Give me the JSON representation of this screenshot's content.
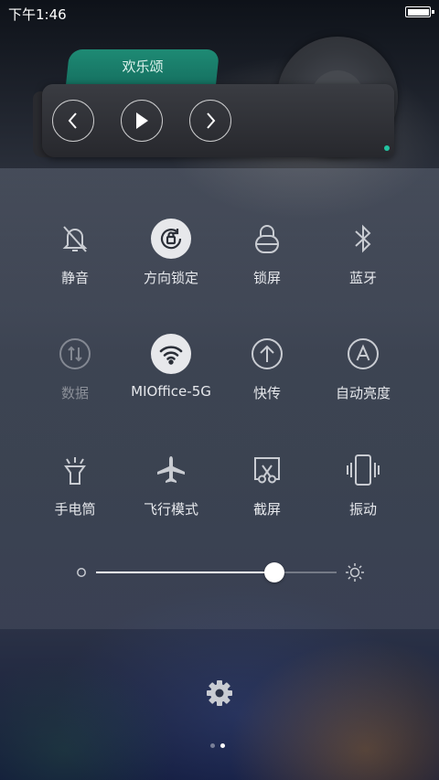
{
  "status_bar": {
    "time": "下午1:46",
    "battery_level_percent": 100
  },
  "music": {
    "title": "欢乐颂",
    "controls": {
      "prev_icon": "chevron-left-icon",
      "play_icon": "play-icon",
      "next_icon": "chevron-right-icon"
    },
    "accent_color": "#1e8a74"
  },
  "toggles": [
    {
      "id": "mute",
      "label": "静音",
      "icon": "bell-slash-icon",
      "active": false,
      "disabled": false
    },
    {
      "id": "rotation-lock",
      "label": "方向锁定",
      "icon": "rotation-lock-icon",
      "active": true,
      "disabled": false
    },
    {
      "id": "lock-screen",
      "label": "锁屏",
      "icon": "lock-icon",
      "active": false,
      "disabled": false
    },
    {
      "id": "bluetooth",
      "label": "蓝牙",
      "icon": "bluetooth-icon",
      "active": false,
      "disabled": false
    },
    {
      "id": "data",
      "label": "数据",
      "icon": "data-arrows-icon",
      "active": false,
      "disabled": true
    },
    {
      "id": "wifi",
      "label": "MIOffice-5G",
      "icon": "wifi-icon",
      "active": true,
      "disabled": false
    },
    {
      "id": "quick-share",
      "label": "快传",
      "icon": "upload-circle-icon",
      "active": false,
      "disabled": false
    },
    {
      "id": "auto-brightness",
      "label": "自动亮度",
      "icon": "auto-brightness-icon",
      "active": false,
      "disabled": false
    },
    {
      "id": "flashlight",
      "label": "手电筒",
      "icon": "flashlight-icon",
      "active": false,
      "disabled": false
    },
    {
      "id": "airplane",
      "label": "飞行模式",
      "icon": "airplane-icon",
      "active": false,
      "disabled": false
    },
    {
      "id": "screenshot",
      "label": "截屏",
      "icon": "scissors-icon",
      "active": false,
      "disabled": false
    },
    {
      "id": "vibrate",
      "label": "振动",
      "icon": "vibrate-icon",
      "active": false,
      "disabled": false
    }
  ],
  "brightness": {
    "level": 0.74,
    "low_icon": "brightness-low-icon",
    "high_icon": "sun-icon"
  },
  "settings": {
    "icon": "gear-icon"
  },
  "pager": {
    "count": 2,
    "current": 1
  }
}
